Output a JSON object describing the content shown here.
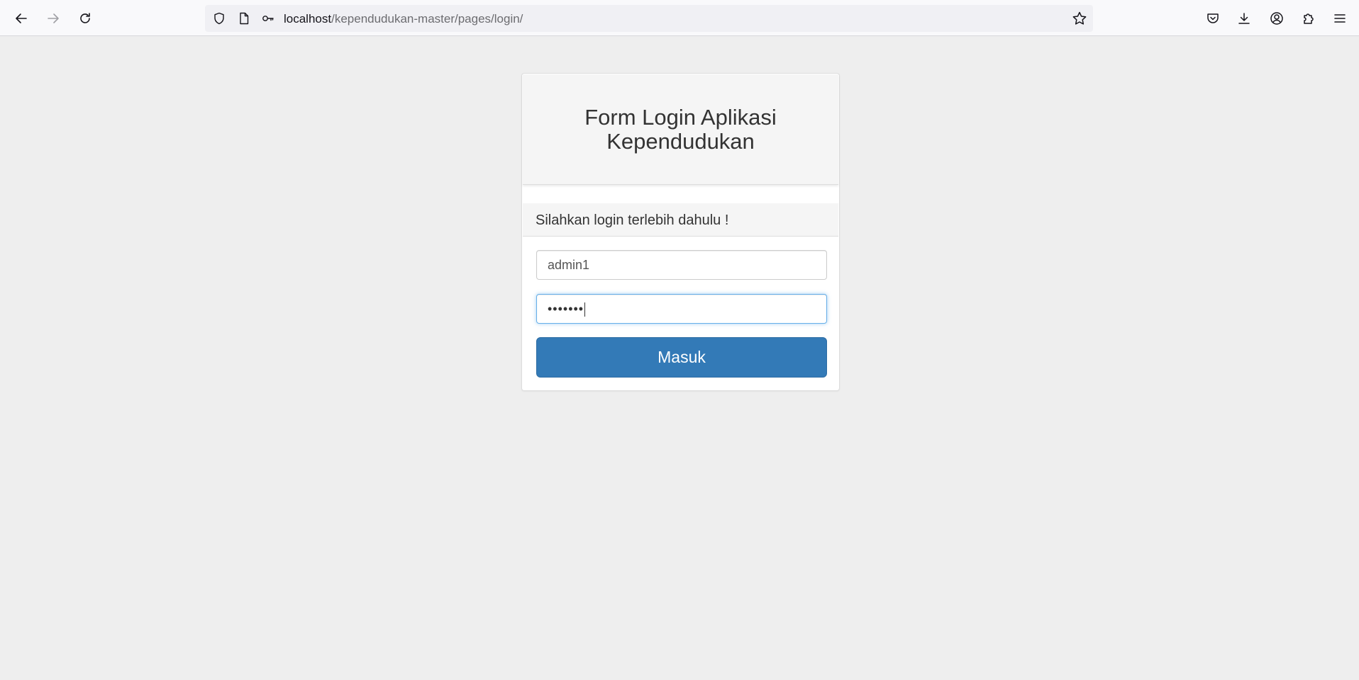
{
  "browser": {
    "url_host": "localhost",
    "url_path": "/kependudukan-master/pages/login/",
    "icons": {
      "back": "arrow-left-icon",
      "forward": "arrow-right-icon",
      "reload": "reload-icon",
      "shield": "shield-icon",
      "page": "page-icon",
      "key": "key-icon",
      "bookmark": "star-icon",
      "pocket": "pocket-icon",
      "downloads": "download-icon",
      "account": "account-icon",
      "extensions": "puzzle-icon",
      "menu": "hamburger-menu-icon"
    }
  },
  "login": {
    "title": "Form Login Aplikasi Kependudukan",
    "subtitle": "Silahkan login terlebih dahulu !",
    "username_value": "admin1",
    "password_masked": "•••••••",
    "submit_label": "Masuk"
  },
  "colors": {
    "button_primary": "#337ab7",
    "page_background": "#eeeeee",
    "focus_border": "#66afe9"
  }
}
